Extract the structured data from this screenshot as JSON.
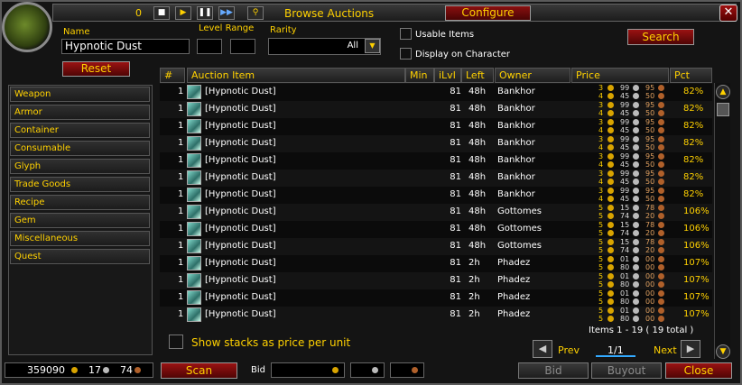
{
  "window": {
    "title": "Browse Auctions",
    "count": "0",
    "configure_label": "Configure",
    "close_x": "✕"
  },
  "filters": {
    "name_label": "Name",
    "name_value": "Hypnotic Dust",
    "level_range_label": "Level Range",
    "rarity_label": "Rarity",
    "rarity_value": "All",
    "usable_items_label": "Usable Items",
    "display_on_character_label": "Display on Character",
    "search_label": "Search",
    "reset_label": "Reset"
  },
  "categories": [
    "Weapon",
    "Armor",
    "Container",
    "Consumable",
    "Glyph",
    "Trade Goods",
    "Recipe",
    "Gem",
    "Miscellaneous",
    "Quest"
  ],
  "columns": {
    "num": "#",
    "item": "Auction Item",
    "min": "Min",
    "ilvl": "iLvl",
    "left": "Left",
    "owner": "Owner",
    "price": "Price",
    "pct": "Pct"
  },
  "rows": [
    {
      "num": "1",
      "name": "[Hypnotic Dust]",
      "ilvl": "81",
      "left": "48h",
      "owner": "Bankhor",
      "p1": [
        "3",
        "99",
        "95"
      ],
      "p2": [
        "4",
        "45",
        "50"
      ],
      "pct": "82%"
    },
    {
      "num": "1",
      "name": "[Hypnotic Dust]",
      "ilvl": "81",
      "left": "48h",
      "owner": "Bankhor",
      "p1": [
        "3",
        "99",
        "95"
      ],
      "p2": [
        "4",
        "45",
        "50"
      ],
      "pct": "82%"
    },
    {
      "num": "1",
      "name": "[Hypnotic Dust]",
      "ilvl": "81",
      "left": "48h",
      "owner": "Bankhor",
      "p1": [
        "3",
        "99",
        "95"
      ],
      "p2": [
        "4",
        "45",
        "50"
      ],
      "pct": "82%"
    },
    {
      "num": "1",
      "name": "[Hypnotic Dust]",
      "ilvl": "81",
      "left": "48h",
      "owner": "Bankhor",
      "p1": [
        "3",
        "99",
        "95"
      ],
      "p2": [
        "4",
        "45",
        "50"
      ],
      "pct": "82%"
    },
    {
      "num": "1",
      "name": "[Hypnotic Dust]",
      "ilvl": "81",
      "left": "48h",
      "owner": "Bankhor",
      "p1": [
        "3",
        "99",
        "95"
      ],
      "p2": [
        "4",
        "45",
        "50"
      ],
      "pct": "82%"
    },
    {
      "num": "1",
      "name": "[Hypnotic Dust]",
      "ilvl": "81",
      "left": "48h",
      "owner": "Bankhor",
      "p1": [
        "3",
        "99",
        "95"
      ],
      "p2": [
        "4",
        "45",
        "50"
      ],
      "pct": "82%"
    },
    {
      "num": "1",
      "name": "[Hypnotic Dust]",
      "ilvl": "81",
      "left": "48h",
      "owner": "Bankhor",
      "p1": [
        "3",
        "99",
        "95"
      ],
      "p2": [
        "4",
        "45",
        "50"
      ],
      "pct": "82%"
    },
    {
      "num": "1",
      "name": "[Hypnotic Dust]",
      "ilvl": "81",
      "left": "48h",
      "owner": "Gottomes",
      "p1": [
        "5",
        "15",
        "78"
      ],
      "p2": [
        "5",
        "74",
        "20"
      ],
      "pct": "106%"
    },
    {
      "num": "1",
      "name": "[Hypnotic Dust]",
      "ilvl": "81",
      "left": "48h",
      "owner": "Gottomes",
      "p1": [
        "5",
        "15",
        "78"
      ],
      "p2": [
        "5",
        "74",
        "20"
      ],
      "pct": "106%"
    },
    {
      "num": "1",
      "name": "[Hypnotic Dust]",
      "ilvl": "81",
      "left": "48h",
      "owner": "Gottomes",
      "p1": [
        "5",
        "15",
        "78"
      ],
      "p2": [
        "5",
        "74",
        "20"
      ],
      "pct": "106%"
    },
    {
      "num": "1",
      "name": "[Hypnotic Dust]",
      "ilvl": "81",
      "left": "2h",
      "owner": "Phadez",
      "p1": [
        "5",
        "01",
        "00"
      ],
      "p2": [
        "5",
        "80",
        "00"
      ],
      "pct": "107%"
    },
    {
      "num": "1",
      "name": "[Hypnotic Dust]",
      "ilvl": "81",
      "left": "2h",
      "owner": "Phadez",
      "p1": [
        "5",
        "01",
        "00"
      ],
      "p2": [
        "5",
        "80",
        "00"
      ],
      "pct": "107%"
    },
    {
      "num": "1",
      "name": "[Hypnotic Dust]",
      "ilvl": "81",
      "left": "2h",
      "owner": "Phadez",
      "p1": [
        "5",
        "01",
        "00"
      ],
      "p2": [
        "5",
        "80",
        "00"
      ],
      "pct": "107%"
    },
    {
      "num": "1",
      "name": "[Hypnotic Dust]",
      "ilvl": "81",
      "left": "2h",
      "owner": "Phadez",
      "p1": [
        "5",
        "01",
        "00"
      ],
      "p2": [
        "5",
        "80",
        "00"
      ],
      "pct": "107%"
    }
  ],
  "footer": {
    "show_stacks_label": "Show stacks as price per unit",
    "items_info": "Items 1 - 19  ( 19 total )",
    "prev_label": "Prev",
    "next_label": "Next",
    "page": "1/1",
    "money_gold": "359090",
    "money_silver": "17",
    "money_copper": "74",
    "scan_label": "Scan",
    "bid_label": "Bid",
    "bid_button": "Bid",
    "buyout_button": "Buyout",
    "close_button": "Close"
  }
}
